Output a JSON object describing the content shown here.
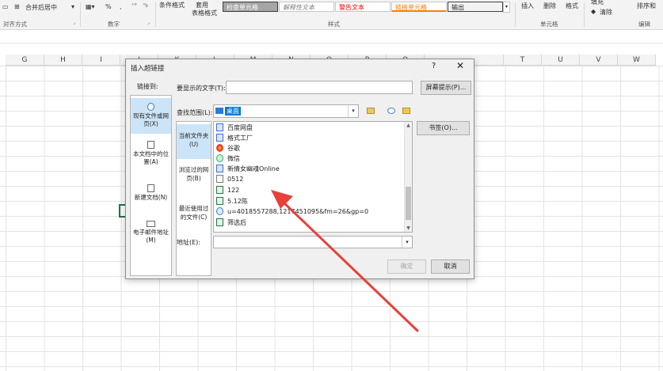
{
  "ribbon": {
    "merge_center": "合并后居中",
    "percent": "%",
    "comma": ",",
    "conditional_format": "条件格式",
    "table_format_1": "套用",
    "table_format_2": "表格格式",
    "styles": [
      "检查单元格",
      "解释性文本",
      "警告文本",
      "链接单元格",
      "输出"
    ],
    "insert": "插入",
    "delete": "删除",
    "format": "格式",
    "fill": "填充",
    "clear": "清除",
    "sort_filter": "排序和",
    "group_alignment": "对齐方式",
    "group_number": "数字",
    "group_styles": "样式",
    "group_cells": "单元格",
    "group_editing": "编辑"
  },
  "columns": [
    "G",
    "H",
    "I",
    "J",
    "K",
    "L",
    "M",
    "N",
    "O",
    "P",
    "Q",
    "T",
    "U",
    "V",
    "W"
  ],
  "dialog": {
    "title": "插入超链接",
    "help": "?",
    "close": "✕",
    "link_to_label": "链接到:",
    "link_targets": [
      "现有文件或网页(X)",
      "本文档中的位置(A)",
      "新建文档(N)",
      "电子邮件地址(M)"
    ],
    "display_text_label": "要显示的文字(T):",
    "display_text_value": "",
    "screentip_button": "屏幕提示(P)...",
    "look_in_label": "查找范围(L):",
    "look_in_value": "桌面",
    "sub_nav": [
      "当前文件夹(U)",
      "浏览过的网页(B)",
      "最近使用过的文件(C)"
    ],
    "bookmark_button": "书签(O)...",
    "files": [
      {
        "name": "百度网盘",
        "icon": "app"
      },
      {
        "name": "格式工厂",
        "icon": "app"
      },
      {
        "name": "谷歌",
        "icon": "chrome"
      },
      {
        "name": "微信",
        "icon": "wechat"
      },
      {
        "name": "新倩女幽魂Online",
        "icon": "app"
      },
      {
        "name": "0512",
        "icon": "doc"
      },
      {
        "name": "122",
        "icon": "xls"
      },
      {
        "name": "5.12陈",
        "icon": "xls"
      },
      {
        "name": "u=4018557288,1217451095&fm=26&gp=0",
        "icon": "ie"
      },
      {
        "name": "筛选后",
        "icon": "xls"
      }
    ],
    "address_label": "地址(E):",
    "address_value": "",
    "ok_button": "确定",
    "cancel_button": "取消"
  },
  "colors": {
    "accent": "#0078d7",
    "annotation_arrow": "#e8403a",
    "excel_green": "#217346"
  }
}
